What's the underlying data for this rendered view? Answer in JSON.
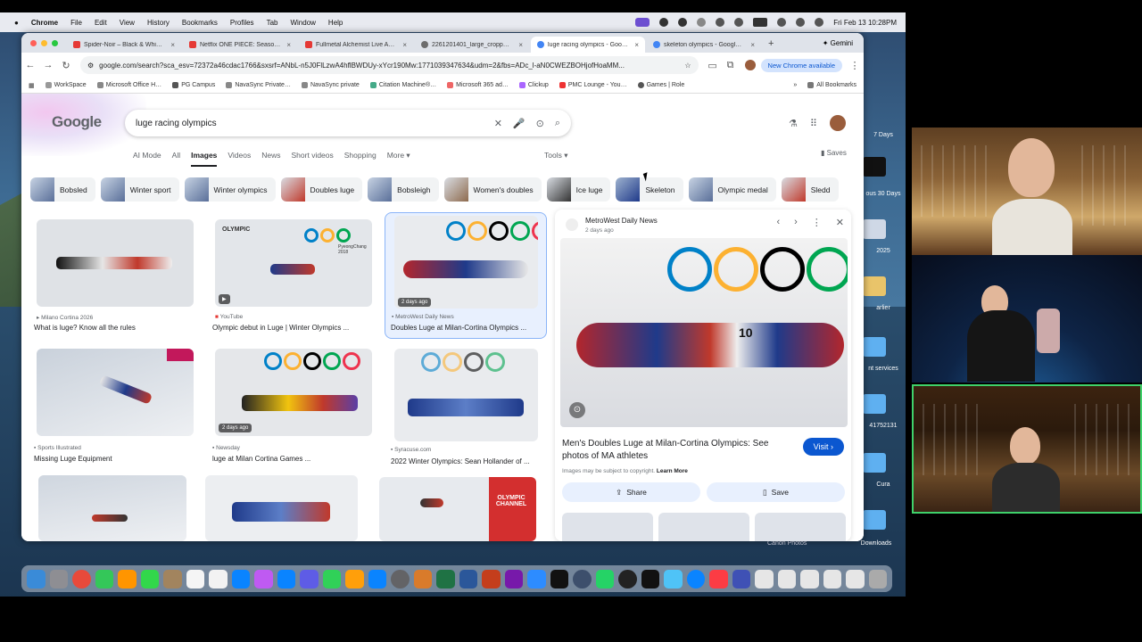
{
  "menubar": {
    "app": "Chrome",
    "items": [
      "File",
      "Edit",
      "View",
      "History",
      "Bookmarks",
      "Profiles",
      "Tab",
      "Window",
      "Help"
    ],
    "clock": "Fri Feb 13  10:28PM"
  },
  "tabs": [
    {
      "title": "Spider-Noir – Black & Whi…",
      "color": "#e53935"
    },
    {
      "title": "Netflix ONE PIECE: Season…",
      "color": "#e53935"
    },
    {
      "title": "Fullmetal Alchemist Live A…",
      "color": "#e53935"
    },
    {
      "title": "2261201401_large_cropp…",
      "color": "#6d6d6d"
    },
    {
      "title": "luge racing olympics - Goo…",
      "color": "#4285f4",
      "active": true
    },
    {
      "title": "skeleton olympics - Googl…",
      "color": "#4285f4"
    }
  ],
  "browser": {
    "new_tab": "+",
    "gemini": "✦ Gemini",
    "url": "google.com/search?sca_esv=72372a46cdac1766&sxsrf=ANbL-n5J0FlLzwA4hflBWDUy-xYcr190Mw:1771039347634&udm=2&fbs=ADc_l-aN0CWEZBOHjofHoaMM...",
    "new_chrome": "New Chrome available",
    "bookmarks": [
      "WorkSpace",
      "Microsoft Office H…",
      "PG Campus",
      "NavaSync Private…",
      "NavaSync private",
      "Citation Machine®…",
      "Microsoft 365 ad…",
      "Clickup",
      "PMC Lounge - You…",
      "Games | Role"
    ],
    "all_bookmarks": "All Bookmarks"
  },
  "search": {
    "logo": "Google",
    "query": "luge racing olympics",
    "nav": [
      "AI Mode",
      "All",
      "Images",
      "Videos",
      "News",
      "Short videos",
      "Shopping",
      "More ▾"
    ],
    "active_nav": "Images",
    "tools": "Tools ▾",
    "saves": "Saves",
    "chips": [
      "Bobsled",
      "Winter sport",
      "Winter olympics",
      "Doubles luge",
      "Bobsleigh",
      "Women's doubles",
      "Ice luge",
      "Skeleton",
      "Olympic medal",
      "Sledd"
    ]
  },
  "results": [
    {
      "source": "Milano Cortina 2026",
      "title": "What is luge? Know all the rules"
    },
    {
      "source": "YouTube",
      "title": "Olympic debut in Luge | Winter Olympics ..."
    },
    {
      "source": "MetroWest Daily News",
      "title": "Doubles Luge at Milan-Cortina Olympics ...",
      "badge": "2 days ago"
    },
    {
      "source": "Sports Illustrated",
      "title": "Missing Luge Equipment"
    },
    {
      "source": "Newsday",
      "title": "luge at Milan Cortina Games ...",
      "badge": "2 days ago"
    },
    {
      "source": "Syracuse.com",
      "title": "2022 Winter Olympics: Sean Hollander of ..."
    }
  ],
  "thumb_text": {
    "olympic": "OLYMPIC",
    "pyeongchang": "PyeongChang 2018",
    "olympic_channel": "OLYMPIC CHANNEL",
    "sled_number": "10"
  },
  "panel": {
    "source": "MetroWest Daily News",
    "date": "2 days ago",
    "title": "Men's Doubles Luge at Milan-Cortina Olympics: See photos of MA athletes",
    "visit": "Visit ›",
    "copyright": "Images may be subject to copyright.",
    "learn_more": "Learn More",
    "share": "Share",
    "save": "Save"
  },
  "desktop_labels": {
    "l1": "7 Days",
    "l2": "ous 30 Days",
    "l3": "2025",
    "l4": "arlier",
    "l5": "nt services",
    "l6": "41752131",
    "l7": "Cura",
    "l8": "Canon Photos",
    "l9": "Downloads"
  },
  "colors": {
    "accent": "#0b57d0",
    "chrome_tab_bg": "#dfe3ea",
    "video_border": "#3fd16a"
  }
}
